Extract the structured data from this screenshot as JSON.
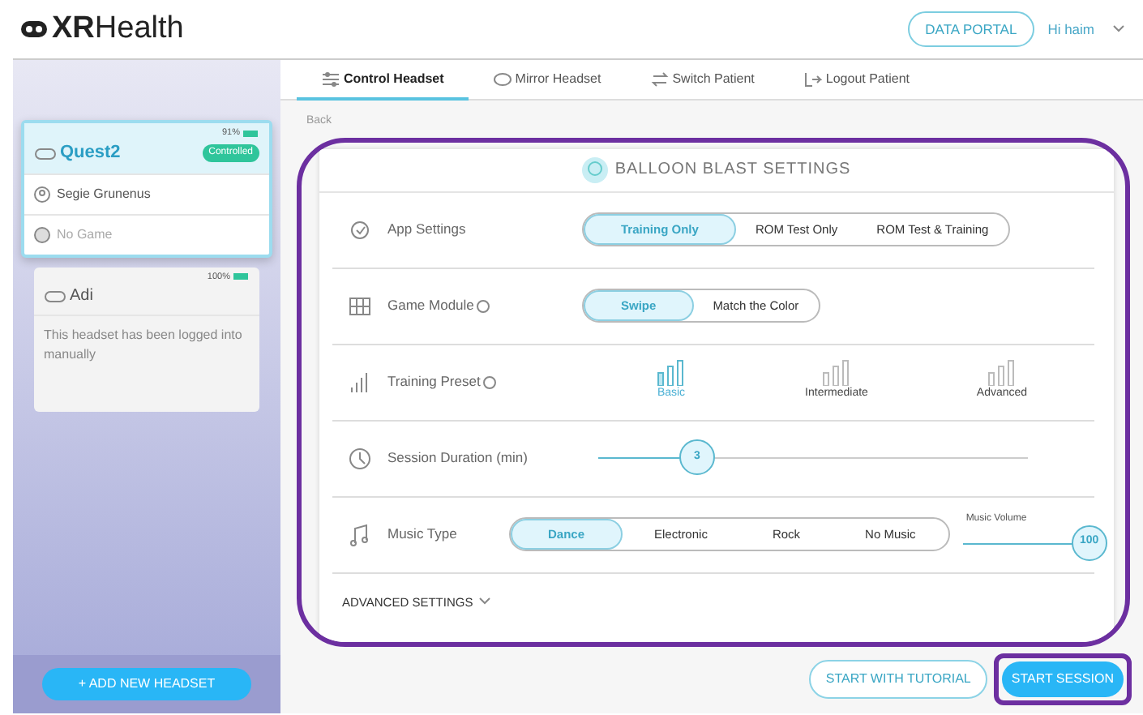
{
  "header": {
    "logo": "**XR**Health",
    "portal_button": "DATA PORTAL",
    "user": "Hi haim"
  },
  "tabs": [
    {
      "label": "Control Headset",
      "selected": true
    },
    {
      "label": "Mirror Headset",
      "selected": false
    },
    {
      "label": "Switch Patient",
      "selected": false
    },
    {
      "label": "Logout Patient",
      "selected": false
    }
  ],
  "headsets": [
    {
      "name": "Quest2",
      "battery": "91%",
      "selected": true,
      "status": "Controlled",
      "patient": "Segie Grunenus",
      "game": "No Game"
    },
    {
      "name": "Adi",
      "battery": "100%",
      "selected": false,
      "message": "This headset has been logged into manually"
    }
  ],
  "add_headset": "+ ADD NEW HEADSET",
  "back": "Back",
  "settings": {
    "title": "BALLOON BLAST SETTINGS",
    "rows": [
      {
        "kind": "segmented",
        "label": "App Settings",
        "options": [
          {
            "label": "Training Only",
            "selected": true
          },
          {
            "label": "ROM Test Only",
            "selected": false
          },
          {
            "label": "ROM Test & Training",
            "selected": false
          }
        ]
      },
      {
        "kind": "segmented",
        "label": "Game Module",
        "help": true,
        "options": [
          {
            "label": "Swipe",
            "selected": true
          },
          {
            "label": "Match the Color",
            "selected": false
          }
        ]
      },
      {
        "kind": "presets",
        "label": "Training Preset",
        "help": true,
        "options": [
          {
            "label": "Basic",
            "selected": true
          },
          {
            "label": "Intermediate",
            "selected": false
          },
          {
            "label": "Advanced",
            "selected": false
          }
        ]
      },
      {
        "kind": "slider",
        "label": "Session Duration (min)",
        "value": "3",
        "level": 0.23
      },
      {
        "kind": "music",
        "label": "Music Type",
        "options": [
          {
            "label": "Dance",
            "selected": true
          },
          {
            "label": "Electronic",
            "selected": false
          },
          {
            "label": "Rock",
            "selected": false
          },
          {
            "label": "No Music",
            "selected": false
          }
        ],
        "volume_label": "Music Volume",
        "volume": "100",
        "level": 1
      }
    ],
    "advanced": "ADVANCED SETTINGS"
  },
  "buttons": [
    "START WITH TUTORIAL",
    "START SESSION"
  ]
}
